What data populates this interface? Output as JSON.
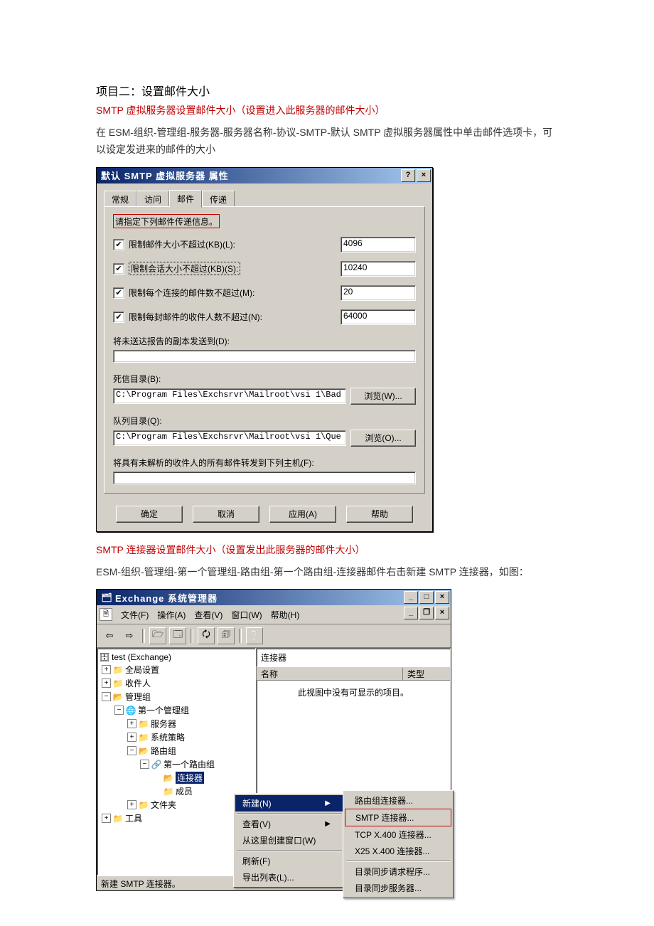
{
  "doc": {
    "title": "项目二：设置邮件大小",
    "sub1": "SMTP 虚拟服务器设置邮件大小（设置进入此服务器的邮件大小）",
    "para1": "在 ESM-组织-管理组-服务器-服务器名称-协议-SMTP-默认 SMTP 虚拟服务器属性中单击邮件选项卡，可以设定发进来的邮件的大小",
    "sub2": "SMTP 连接器设置邮件大小（设置发出此服务器的邮件大小）",
    "para2": "ESM-组织-管理组-第一个管理组-路由组-第一个路由组-连接器邮件右击新建 SMTP 连接器，如图："
  },
  "dialog": {
    "title": "默认 SMTP 虚拟服务器 属性",
    "help_btn": "?",
    "close_btn": "×",
    "tabs": {
      "general": "常规",
      "access": "访问",
      "mail": "邮件",
      "delivery": "传递"
    },
    "info": "请指定下列邮件传递信息。",
    "rows": {
      "limit_msg_size": {
        "label": "限制邮件大小不超过(KB)(L):",
        "value": "4096"
      },
      "limit_sess_size": {
        "label": "限制会话大小不超过(KB)(S):",
        "value": "10240"
      },
      "limit_msg_count": {
        "label": "限制每个连接的邮件数不超过(M):",
        "value": "20"
      },
      "limit_rcpt": {
        "label": "限制每封邮件的收件人数不超过(N):",
        "value": "64000"
      }
    },
    "ndr_label": "将未送达报告的副本发送到(D):",
    "ndr_value": "",
    "badmail_label": "死信目录(B):",
    "badmail_path": "C:\\Program Files\\Exchsrvr\\Mailroot\\vsi 1\\Bad",
    "browse_w": "浏览(W)...",
    "queue_label": "队列目录(Q):",
    "queue_path": "C:\\Program Files\\Exchsrvr\\Mailroot\\vsi 1\\Que",
    "browse_o": "浏览(O)...",
    "forward_label": "将具有未解析的收件人的所有邮件转发到下列主机(F):",
    "forward_value": "",
    "buttons": {
      "ok": "确定",
      "cancel": "取消",
      "apply": "应用(A)",
      "help": "帮助"
    }
  },
  "mmc": {
    "title": "Exchange 系统管理器",
    "min_btn": "_",
    "max_btn": "□",
    "close_btn": "×",
    "menu": {
      "file": "文件(F)",
      "action": "操作(A)",
      "view": "查看(V)",
      "window": "窗口(W)",
      "help": "帮助(H)"
    },
    "mdi": {
      "min": "_",
      "restore": "❐",
      "close": "×"
    },
    "tree": {
      "root": "test (Exchange)",
      "global": "全局设置",
      "recipients": "收件人",
      "admin_groups": "管理组",
      "first_admin": "第一个管理组",
      "servers": "服务器",
      "policies": "系统策略",
      "routing": "路由组",
      "first_route": "第一个路由组",
      "connectors": "连接器",
      "members": "成员",
      "folders": "文件夹",
      "tools": "工具"
    },
    "list": {
      "title": "连接器",
      "col_name": "名称",
      "col_type": "类型",
      "empty": "此视图中没有可显示的项目。"
    },
    "ctx": {
      "new": "新建(N)",
      "view": "查看(V)",
      "new_window": "从这里创建窗口(W)",
      "refresh": "刷新(F)",
      "export": "导出列表(L)..."
    },
    "submenu": {
      "route_conn": "路由组连接器...",
      "smtp_conn": "SMTP 连接器...",
      "tcp_x400": "TCP X.400 连接器...",
      "x25_x400": "X25 X.400 连接器...",
      "dirsync_req": "目录同步请求程序...",
      "dirsync_srv": "目录同步服务器..."
    },
    "status": "新建 SMTP 连接器。"
  }
}
